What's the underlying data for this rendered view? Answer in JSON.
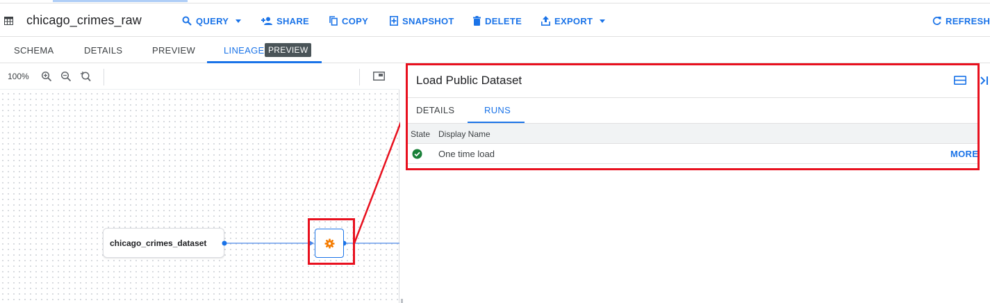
{
  "header": {
    "title": "chicago_crimes_raw",
    "icon": "table-icon",
    "actions": {
      "query": "QUERY",
      "share": "SHARE",
      "copy": "COPY",
      "snapshot": "SNAPSHOT",
      "delete": "DELETE",
      "export": "EXPORT",
      "refresh": "REFRESH"
    }
  },
  "tabs": {
    "schema": "SCHEMA",
    "details": "DETAILS",
    "preview": "PREVIEW",
    "lineage": "LINEAGE",
    "lineage_badge": "PREVIEW",
    "active": "LINEAGE"
  },
  "graph": {
    "zoom_level": "100%",
    "source_node": "chicago_crimes_dataset",
    "process_node_icon": "gear-icon"
  },
  "panel": {
    "title": "Load Public Dataset",
    "tabs": {
      "details": "DETAILS",
      "runs": "RUNS",
      "active": "RUNS"
    },
    "runs_table": {
      "columns": [
        "State",
        "Display Name"
      ],
      "rows": [
        {
          "state": "success",
          "display_name": "One time load",
          "action": "MORE"
        }
      ]
    }
  },
  "colors": {
    "accent": "#1a73e8",
    "highlight": "#e8101e",
    "success": "#188038",
    "process_icon": "#f57c00",
    "badge": "#4a5458"
  }
}
